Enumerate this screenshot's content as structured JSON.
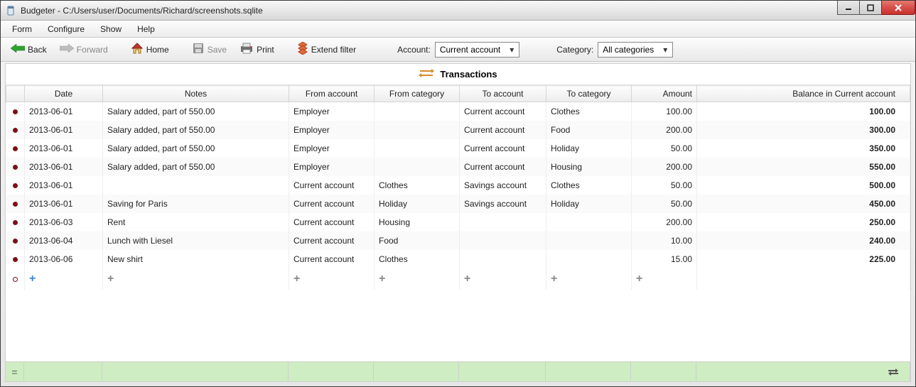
{
  "titlebar": {
    "title": "Budgeter - C:/Users/user/Documents/Richard/screenshots.sqlite"
  },
  "menu": {
    "items": [
      "Form",
      "Configure",
      "Show",
      "Help"
    ]
  },
  "toolbar": {
    "back": "Back",
    "forward": "Forward",
    "home": "Home",
    "save": "Save",
    "print": "Print",
    "extend_filter": "Extend filter",
    "account_label": "Account:",
    "account_value": "Current account",
    "category_label": "Category:",
    "category_value": "All categories"
  },
  "content": {
    "heading": "Transactions",
    "columns": {
      "date": "Date",
      "notes": "Notes",
      "from_account": "From account",
      "from_category": "From category",
      "to_account": "To account",
      "to_category": "To category",
      "amount": "Amount",
      "balance": "Balance in Current account"
    },
    "rows": [
      {
        "date": "2013-06-01",
        "notes": "Salary added, part of 550.00",
        "from_account": "Employer",
        "from_category": "",
        "to_account": "Current account",
        "to_category": "Clothes",
        "amount": "100.00",
        "balance": "100.00"
      },
      {
        "date": "2013-06-01",
        "notes": "Salary added, part of 550.00",
        "from_account": "Employer",
        "from_category": "",
        "to_account": "Current account",
        "to_category": "Food",
        "amount": "200.00",
        "balance": "300.00"
      },
      {
        "date": "2013-06-01",
        "notes": "Salary added, part of 550.00",
        "from_account": "Employer",
        "from_category": "",
        "to_account": "Current account",
        "to_category": "Holiday",
        "amount": "50.00",
        "balance": "350.00"
      },
      {
        "date": "2013-06-01",
        "notes": "Salary added, part of 550.00",
        "from_account": "Employer",
        "from_category": "",
        "to_account": "Current account",
        "to_category": "Housing",
        "amount": "200.00",
        "balance": "550.00"
      },
      {
        "date": "2013-06-01",
        "notes": "",
        "from_account": "Current account",
        "from_category": "Clothes",
        "to_account": "Savings account",
        "to_category": "Clothes",
        "amount": "50.00",
        "balance": "500.00"
      },
      {
        "date": "2013-06-01",
        "notes": "Saving for Paris",
        "from_account": "Current account",
        "from_category": "Holiday",
        "to_account": "Savings account",
        "to_category": "Holiday",
        "amount": "50.00",
        "balance": "450.00"
      },
      {
        "date": "2013-06-03",
        "notes": "Rent",
        "from_account": "Current account",
        "from_category": "Housing",
        "to_account": "",
        "to_category": "",
        "amount": "200.00",
        "balance": "250.00"
      },
      {
        "date": "2013-06-04",
        "notes": "Lunch with Liesel",
        "from_account": "Current account",
        "from_category": "Food",
        "to_account": "",
        "to_category": "",
        "amount": "10.00",
        "balance": "240.00"
      },
      {
        "date": "2013-06-06",
        "notes": "New shirt",
        "from_account": "Current account",
        "from_category": "Clothes",
        "to_account": "",
        "to_category": "",
        "amount": "15.00",
        "balance": "225.00"
      }
    ]
  },
  "footer": {
    "equals": "="
  }
}
